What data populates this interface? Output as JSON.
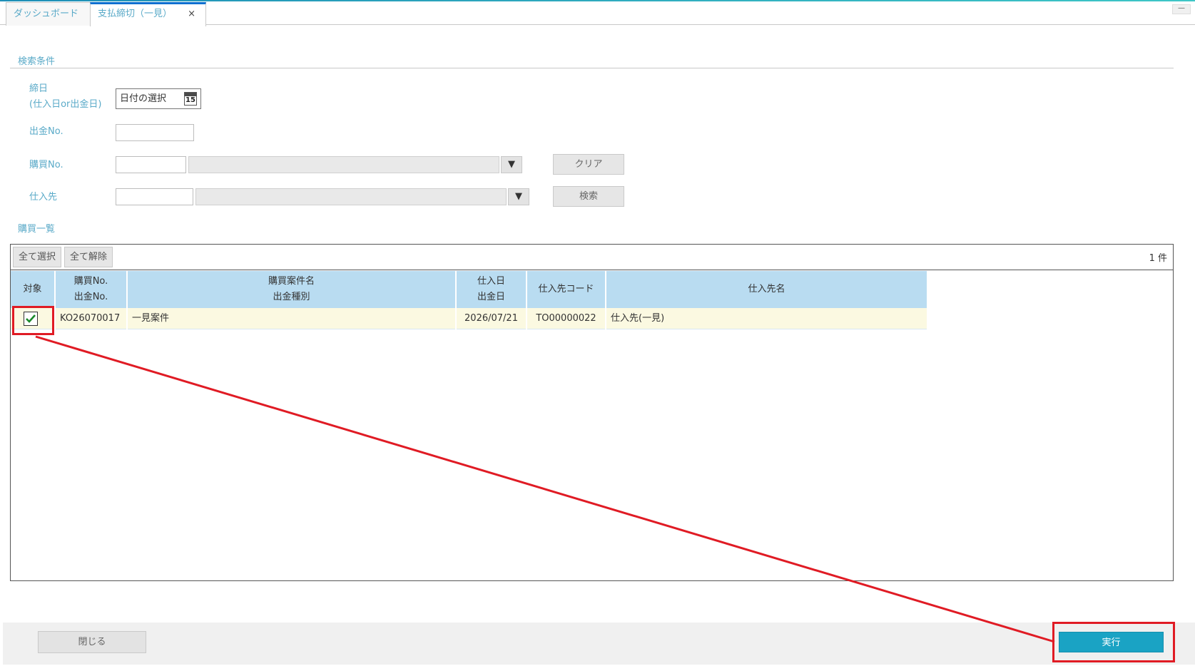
{
  "tabs": [
    {
      "label": "ダッシュボード",
      "active": false
    },
    {
      "label": "支払締切（一見）",
      "active": true,
      "close": "×"
    }
  ],
  "window": {
    "minimize": "—"
  },
  "search": {
    "section_title": "検索条件",
    "closing_date": {
      "label_line1": "締日",
      "label_line2": "(仕入日or出金日)",
      "placeholder": "日付の選択",
      "calendar_day": "15"
    },
    "payment_no": {
      "label": "出金No.",
      "value": ""
    },
    "purchase_no": {
      "label": "購買No.",
      "value": "",
      "name_value": "",
      "dropdown": "▼"
    },
    "supplier": {
      "label": "仕入先",
      "value": "",
      "name_value": "",
      "dropdown": "▼"
    },
    "clear_button": "クリア",
    "search_button": "検索"
  },
  "list": {
    "section_title": "購買一覧",
    "select_all": "全て選択",
    "deselect_all": "全て解除",
    "count": "1 件",
    "columns": [
      {
        "line1": "対象",
        "line2": ""
      },
      {
        "line1": "購買No.",
        "line2": "出金No."
      },
      {
        "line1": "購買案件名",
        "line2": "出金種別"
      },
      {
        "line1": "仕入日",
        "line2": "出金日"
      },
      {
        "line1": "仕入先コード",
        "line2": ""
      },
      {
        "line1": "仕入先名",
        "line2": ""
      }
    ],
    "rows": [
      {
        "checked": true,
        "purchase_no": "KO26070017",
        "project_name": "一見案件",
        "date": "2026/07/21",
        "supplier_code": "TO00000022",
        "supplier_name": "仕入先(一見)"
      }
    ]
  },
  "footer": {
    "close_button": "閉じる",
    "execute_button": "実行"
  },
  "colors": {
    "accent": "#1aa3c4",
    "label": "#5aaac8",
    "header": "#b9dcf1",
    "row": "#fbf9e1",
    "annotation": "#e01b24"
  }
}
